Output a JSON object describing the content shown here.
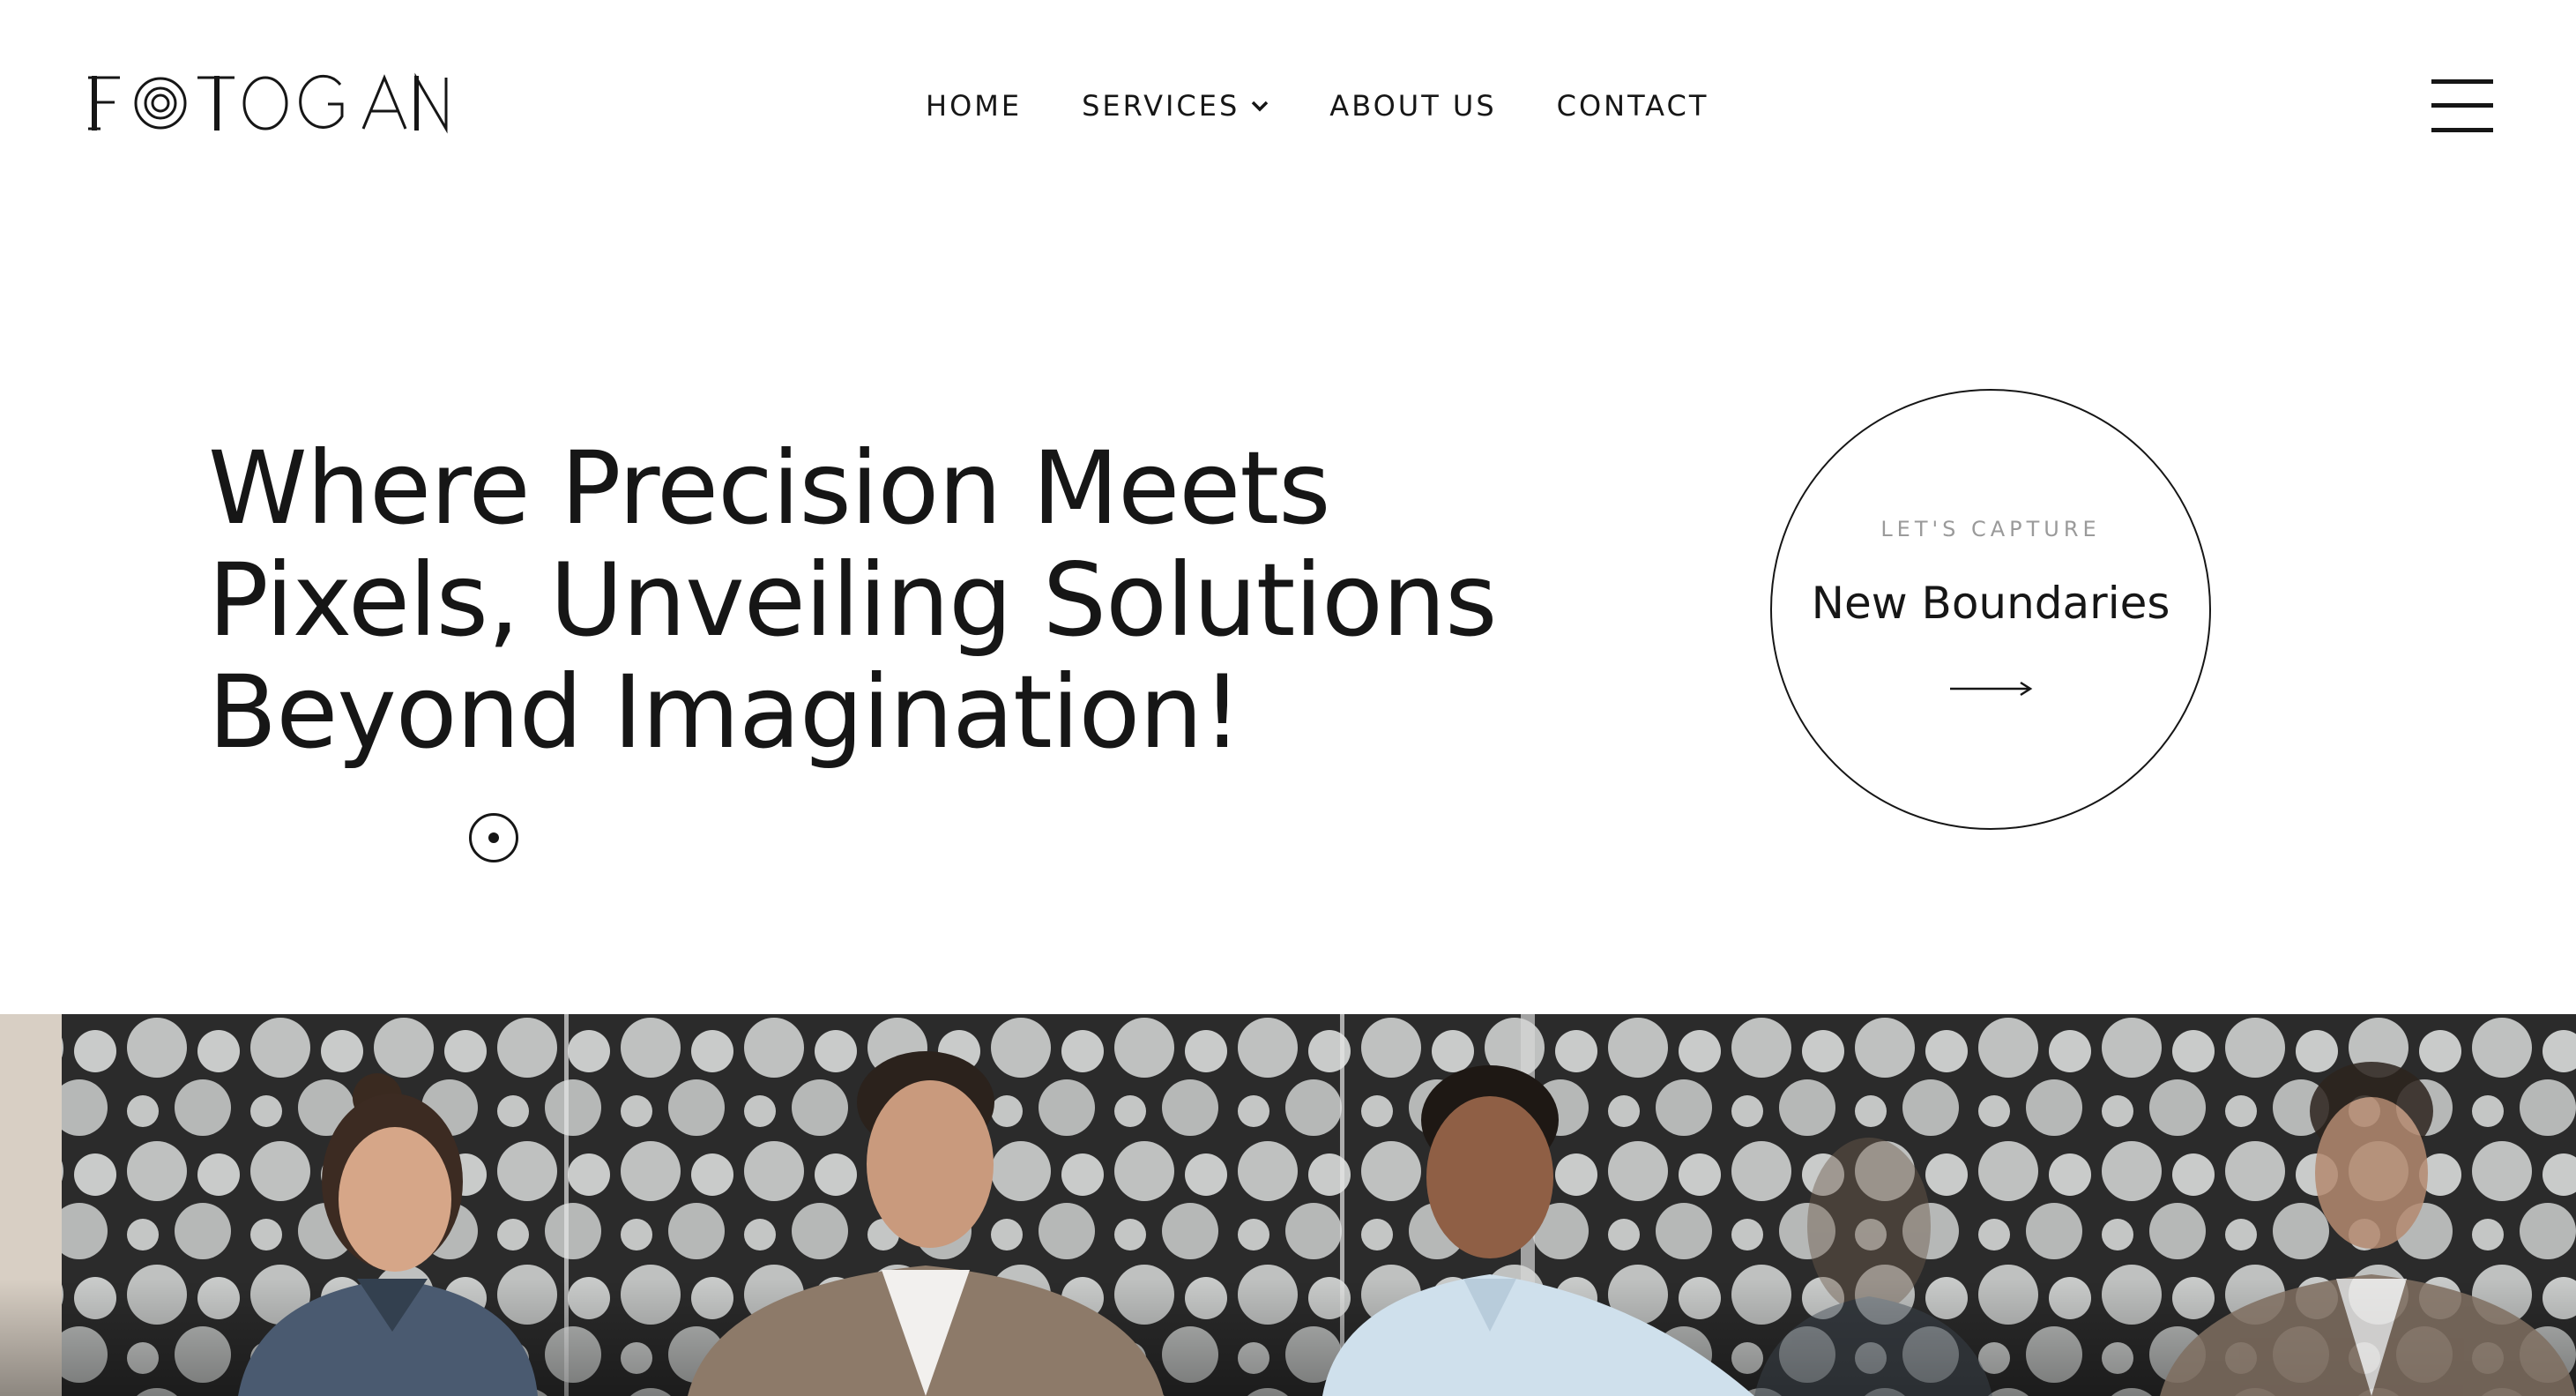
{
  "brand": {
    "name": "FOTOGAN",
    "logo_icon": "camera-lens-logo"
  },
  "nav": {
    "items": [
      {
        "label": "HOME"
      },
      {
        "label": "SERVICES",
        "icon": "chevron-down-icon"
      },
      {
        "label": "ABOUT US"
      },
      {
        "label": "CONTACT"
      }
    ],
    "menu_icon": "hamburger-menu-icon"
  },
  "hero": {
    "headline_lines": [
      "Where Precision Meets",
      "Pixels, Unveiling Solutions",
      "Beyond Imagination!"
    ],
    "scroll_icon": "scroll-down-dot-icon"
  },
  "cta": {
    "eyebrow": "LET'S CAPTURE",
    "title": "New Boundaries",
    "icon": "arrow-right-icon"
  },
  "image": {
    "subject": "Four people working together at a table in an office with dotted glass partitions"
  },
  "colors": {
    "text": "#161616",
    "muted": "#9a9a9a",
    "background": "#ffffff"
  }
}
